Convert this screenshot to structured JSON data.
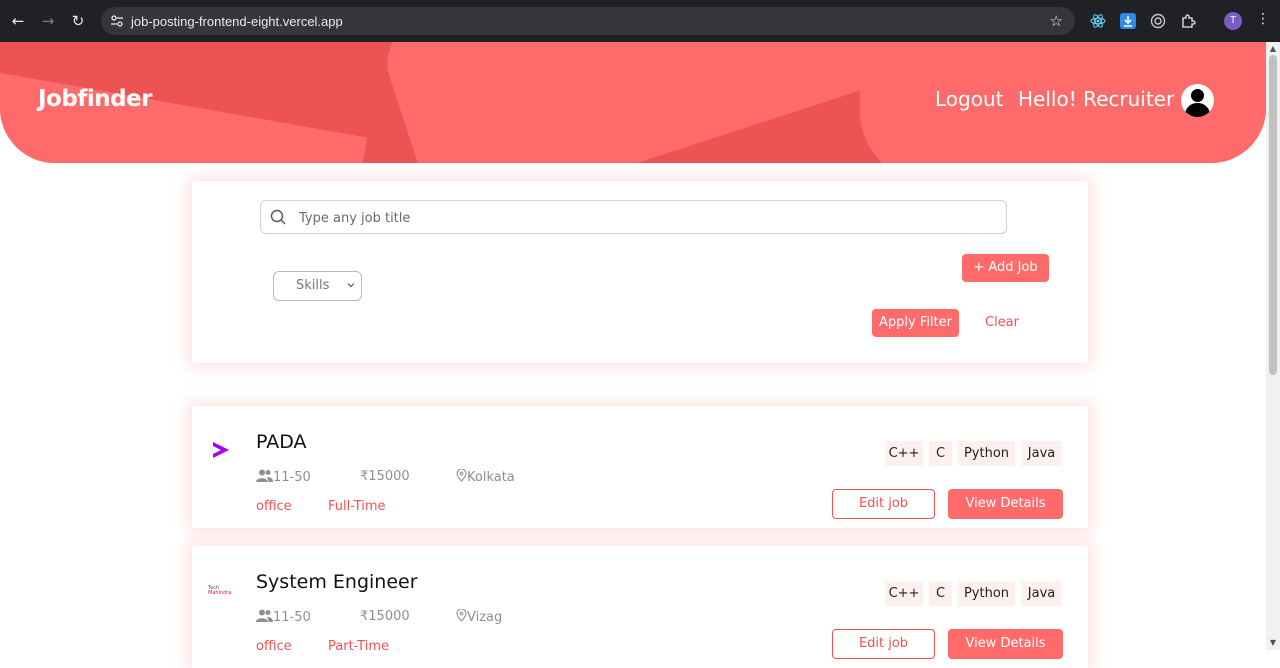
{
  "browser": {
    "url": "job-posting-frontend-eight.vercel.app",
    "profile_initial": "T"
  },
  "header": {
    "brand": "Jobfinder",
    "logout": "Logout",
    "greeting": "Hello! Recruiter"
  },
  "filters": {
    "search_placeholder": "Type any job title",
    "skills_label": "Skills",
    "add_job": "+ Add Job",
    "apply_filter": "Apply Filter",
    "clear": "Clear"
  },
  "jobs": [
    {
      "title": "PADA",
      "logo": "chevron-logo",
      "size": "11-50",
      "salary": "₹15000",
      "location": "Kolkata",
      "mode": "office",
      "type": "Full-Time",
      "skills": [
        "C++",
        "C",
        "Python",
        "Java"
      ],
      "edit_label": "Edit job",
      "view_label": "View Details"
    },
    {
      "title": "System Engineer",
      "logo": "tech-mahindra-logo",
      "logo_text_1": "Tech",
      "logo_text_2": "Mahindra",
      "size": "11-50",
      "salary": "₹15000",
      "location": "Vizag",
      "mode": "office",
      "type": "Part-Time",
      "skills": [
        "C++",
        "C",
        "Python",
        "Java"
      ],
      "edit_label": "Edit job",
      "view_label": "View Details"
    }
  ],
  "colors": {
    "brand_red": "#ed5353",
    "button_red": "#ff6b6b",
    "chip_bg": "#fff0f0",
    "accenture_purple": "#a100ff"
  }
}
